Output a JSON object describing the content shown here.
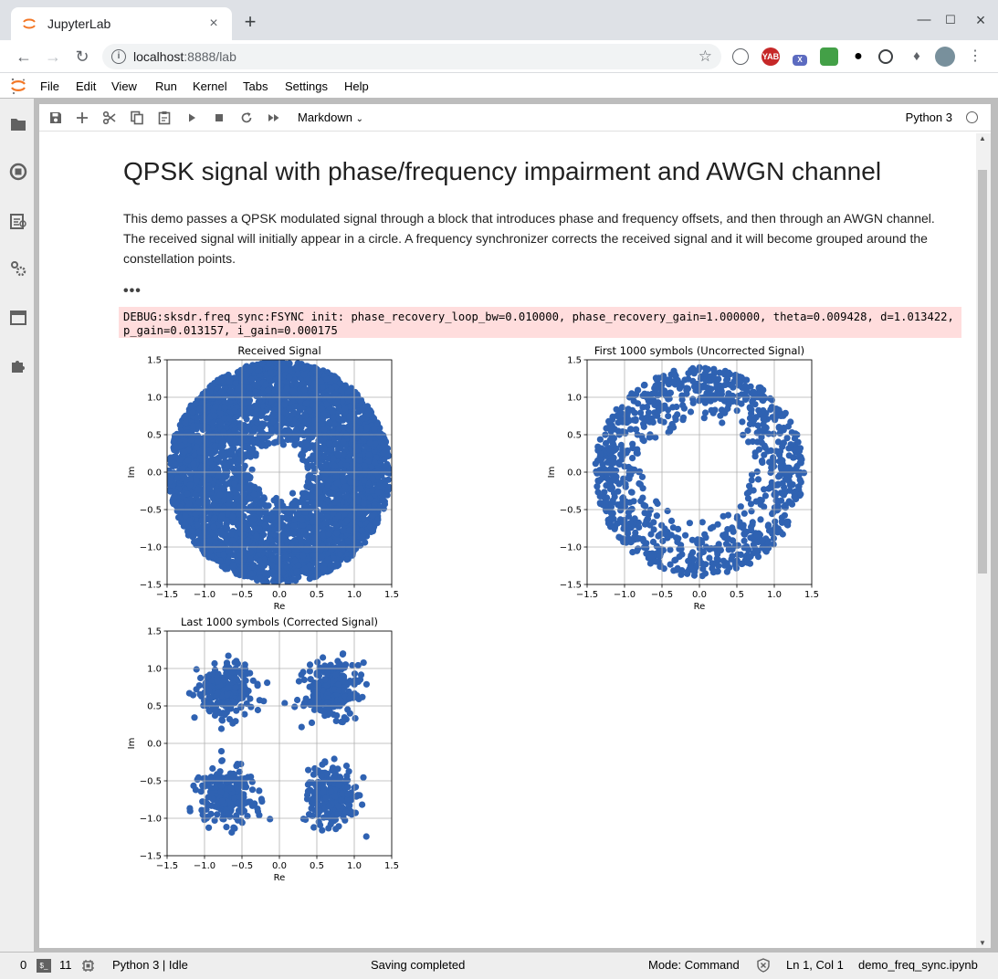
{
  "browser": {
    "tab_title": "JupyterLab",
    "url_host": "localhost",
    "url_path": ":8888/lab",
    "extensions": [
      "YAB",
      "X"
    ]
  },
  "menu": [
    "File",
    "Edit",
    "View",
    "Run",
    "Kernel",
    "Tabs",
    "Settings",
    "Help"
  ],
  "toolbar": {
    "cell_type": "Markdown",
    "kernel": "Python 3"
  },
  "notebook": {
    "title": "QPSK signal with phase/frequency impairment and AWGN channel",
    "paragraph": "This demo passes a QPSK modulated signal through a block that introduces phase and frequency offsets, and then through an AWGN channel. The received signal will initially appear in a circle. A frequency synchronizer corrects the received signal and it will become grouped around the constellation points.",
    "collapsed_marker": "•••",
    "stderr": "DEBUG:sksdr.freq_sync:FSYNC init: phase_recovery_loop_bw=0.010000, phase_recovery_gain=1.000000, theta=0.009428, d=1.013422, p_gain=0.013157, i_gain=0.000175"
  },
  "chart_data": [
    {
      "type": "scatter",
      "title": "Received Signal",
      "xlabel": "Re",
      "ylabel": "Im",
      "xlim": [
        -1.5,
        1.5
      ],
      "ylim": [
        -1.5,
        1.5
      ],
      "ticks": [
        "−1.5",
        "−1.0",
        "−0.5",
        "0.0",
        "0.5",
        "1.0",
        "1.5"
      ],
      "grid": true,
      "color": "#2f62b2",
      "distribution": {
        "kind": "ring",
        "radius_min": 0.32,
        "radius_max": 1.48,
        "points": 4500
      }
    },
    {
      "type": "scatter",
      "title": "First 1000 symbols (Uncorrected Signal)",
      "xlabel": "Re",
      "ylabel": "Im",
      "xlim": [
        -1.5,
        1.5
      ],
      "ylim": [
        -1.5,
        1.5
      ],
      "ticks": [
        "−1.5",
        "−1.0",
        "−0.5",
        "0.0",
        "0.5",
        "1.0",
        "1.5"
      ],
      "grid": true,
      "color": "#2f62b2",
      "distribution": {
        "kind": "ring",
        "radius_min": 0.65,
        "radius_max": 1.4,
        "points": 1000
      }
    },
    {
      "type": "scatter",
      "title": "Last 1000 symbols (Corrected Signal)",
      "xlabel": "Re",
      "ylabel": "Im",
      "xlim": [
        -1.5,
        1.5
      ],
      "ylim": [
        -1.5,
        1.5
      ],
      "ticks": [
        "−1.5",
        "−1.0",
        "−0.5",
        "0.0",
        "0.5",
        "1.0",
        "1.5"
      ],
      "grid": true,
      "color": "#2f62b2",
      "distribution": {
        "kind": "clusters",
        "centers": [
          [
            -0.7,
            0.7
          ],
          [
            0.7,
            0.7
          ],
          [
            -0.7,
            -0.7
          ],
          [
            0.7,
            -0.7
          ]
        ],
        "spread": 0.18,
        "points": 1000
      }
    }
  ],
  "status": {
    "terminals": "0",
    "kernels": "11",
    "kernel_state": "Python 3 | Idle",
    "message": "Saving completed",
    "mode": "Mode: Command",
    "position": "Ln 1, Col 1",
    "filename": "demo_freq_sync.ipynb"
  }
}
